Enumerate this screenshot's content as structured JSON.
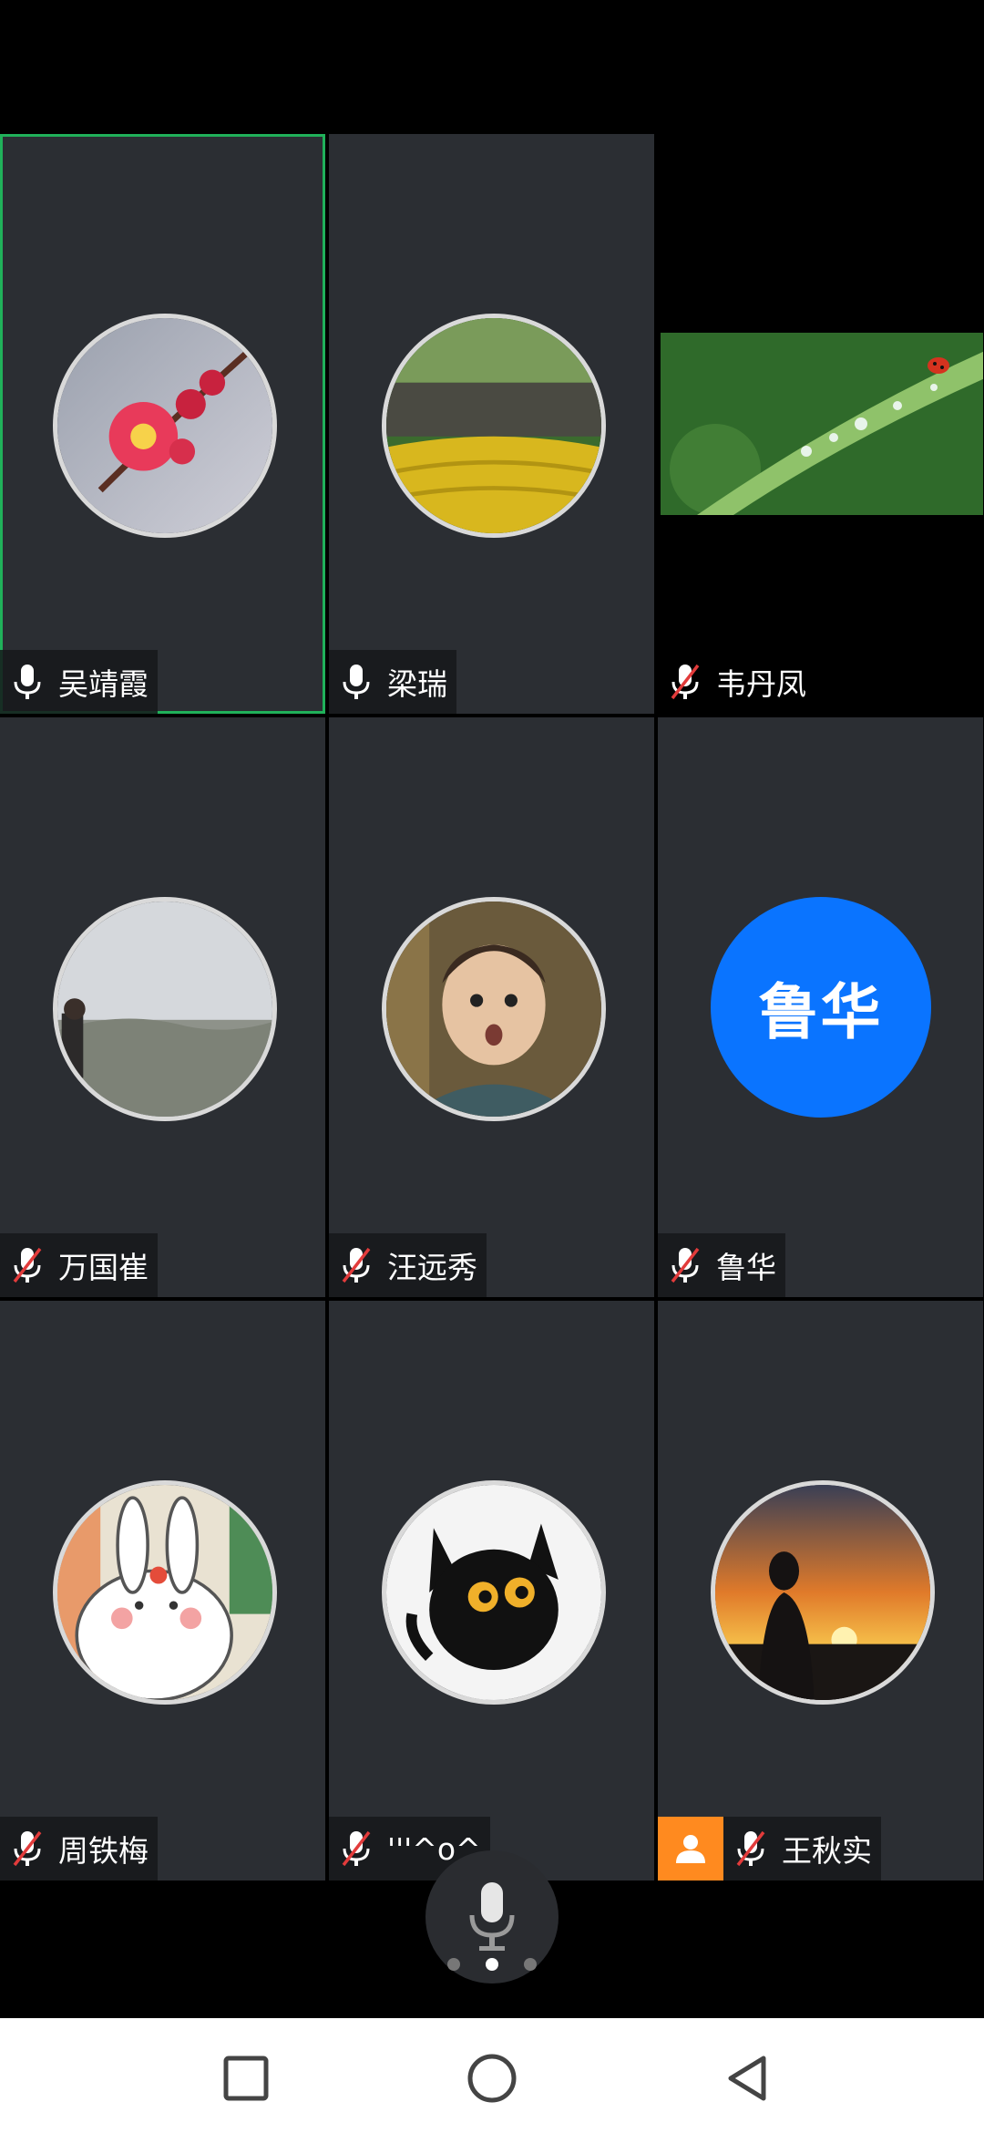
{
  "participants": [
    {
      "name": "吴靖霞",
      "mic": "on",
      "active": true,
      "avatar": "plum-blossom"
    },
    {
      "name": "梁瑞",
      "mic": "on",
      "active": false,
      "avatar": "terraced-village"
    },
    {
      "name": "韦丹凤",
      "mic": "off",
      "active": false,
      "avatar": "leaf-with-ladybug-video"
    },
    {
      "name": "万国崔",
      "mic": "off",
      "active": false,
      "avatar": "man-on-hill"
    },
    {
      "name": "汪远秀",
      "mic": "off",
      "active": false,
      "avatar": "surprised-man"
    },
    {
      "name": "鲁华",
      "mic": "off",
      "active": false,
      "avatar": "initials",
      "initials": "鲁华"
    },
    {
      "name": "周铁梅",
      "mic": "off",
      "active": false,
      "avatar": "cartoon-rabbit"
    },
    {
      "name": "'''^o^",
      "mic": "off",
      "active": false,
      "avatar": "cartoon-black-cat"
    },
    {
      "name": "王秋实",
      "mic": "off",
      "active": false,
      "avatar": "sunset-silhouette",
      "host": true
    }
  ],
  "pager": {
    "pages": 3,
    "current": 2
  },
  "colors": {
    "active_border": "#20b15a",
    "initials_bg": "#0a74ff",
    "host_badge": "#ff8a1f",
    "tile_bg": "#2b2e33"
  },
  "icons": {
    "mic_on": "mic-icon",
    "mic_off": "mic-muted-icon",
    "host": "person-icon"
  }
}
